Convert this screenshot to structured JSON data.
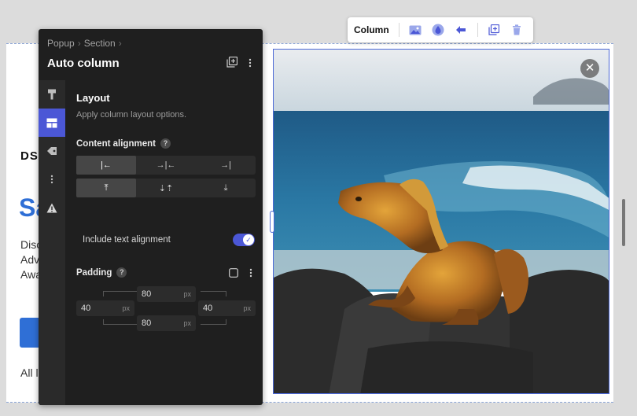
{
  "background": {
    "logo_text": "DS",
    "heading": "Sa",
    "paragraph_lines": [
      "Disc",
      "Adve",
      "Awa"
    ],
    "footer_text": "All la"
  },
  "toolbar": {
    "label": "Column",
    "icons": [
      "image-icon",
      "color-drop-icon",
      "arrow-left-icon",
      "duplicate-icon",
      "trash-icon"
    ]
  },
  "panel": {
    "breadcrumb": [
      "Popup",
      "Section"
    ],
    "title": "Auto column",
    "section_title": "Layout",
    "section_desc": "Apply column layout options.",
    "content_alignment_label": "Content alignment",
    "help_glyph": "?",
    "horizontal_alignment": [
      {
        "glyph": "|←",
        "active": true
      },
      {
        "glyph": "→|←",
        "active": false
      },
      {
        "glyph": "→|",
        "active": false
      }
    ],
    "vertical_alignment": [
      {
        "glyph": "⤒",
        "active": true
      },
      {
        "glyph": "⇣⇡",
        "active": false
      },
      {
        "glyph": "⤓",
        "active": false
      }
    ],
    "include_text_alignment_label": "Include text alignment",
    "include_text_alignment_on": true,
    "padding_label": "Padding",
    "padding": {
      "top": {
        "value": "80",
        "unit": "px"
      },
      "left": {
        "value": "40",
        "unit": "px"
      },
      "right": {
        "value": "40",
        "unit": "px"
      },
      "bottom": {
        "value": "80",
        "unit": "px"
      }
    }
  },
  "colors": {
    "accent": "#4b57d6",
    "panel_bg": "#1f1f1f",
    "selection": "#4b68d6",
    "brand_blue": "#2f6fd6"
  }
}
